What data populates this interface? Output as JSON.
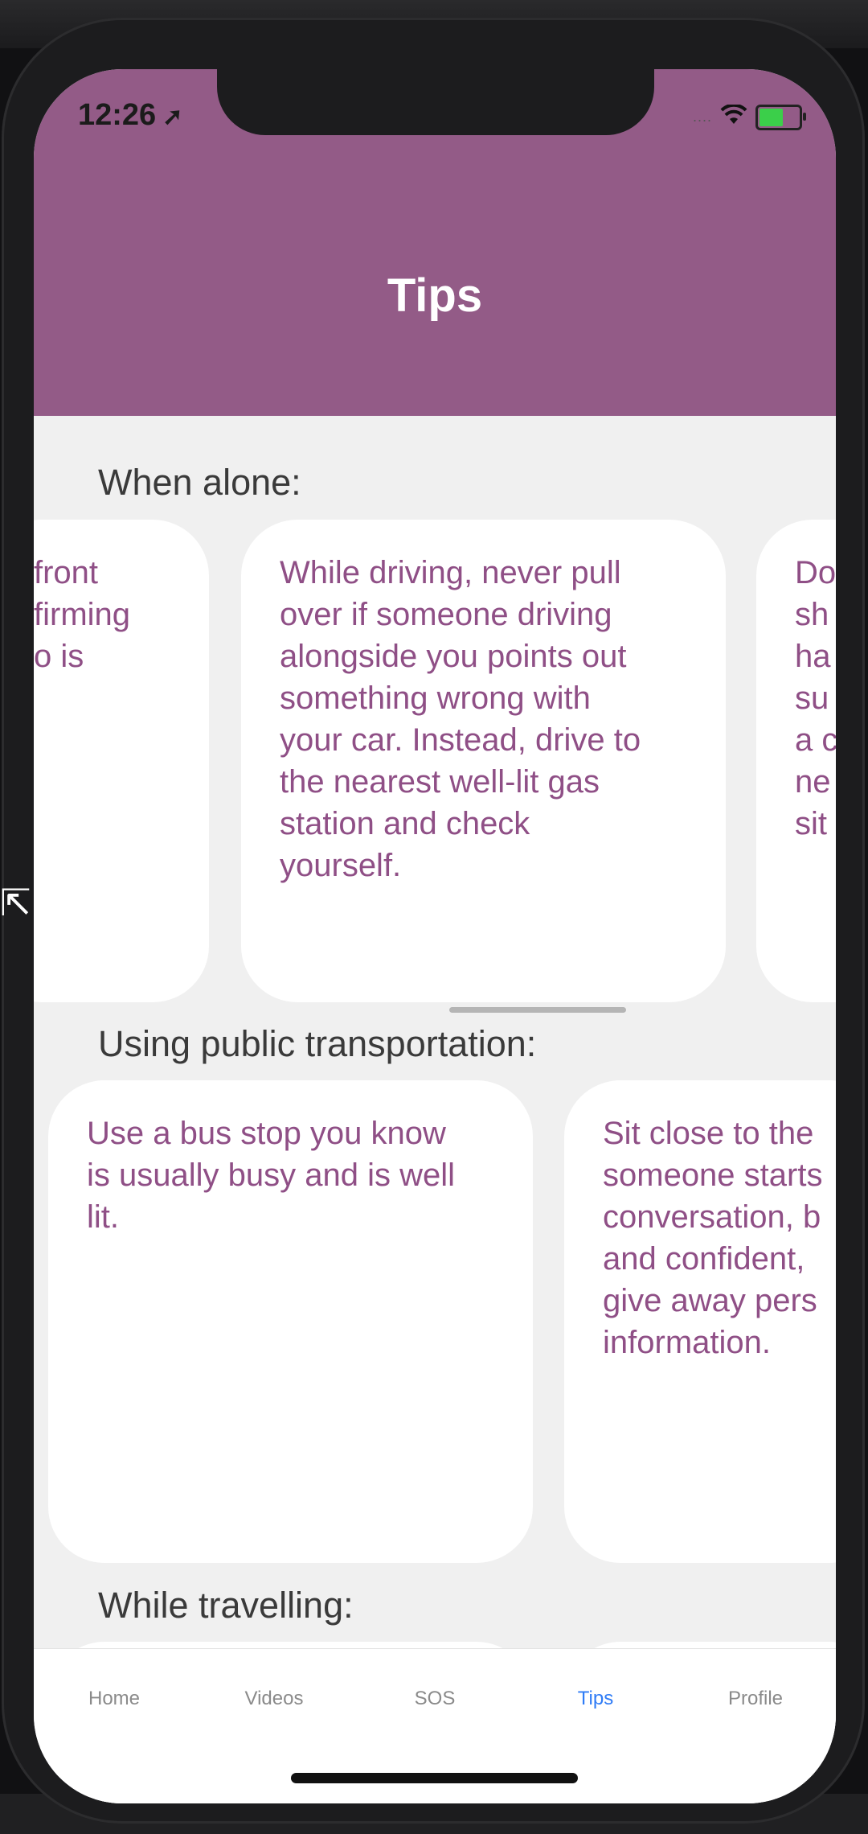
{
  "status_bar": {
    "time": "12:26",
    "signal": "....",
    "wifi_icon": "wifi-icon",
    "battery_icon": "battery-charging-icon"
  },
  "header": {
    "title": "Tips",
    "color": "#935b87"
  },
  "sections": [
    {
      "title": "When alone:",
      "cards": [
        "front\nfirming\no is",
        "While driving, never pull\nover if someone driving\nalongside you points out\nsomething wrong with\nyour car. Instead, drive to\nthe nearest well-lit gas\nstation and check\nyourself.",
        "Do\nsh\nha\nsu\na c\nne\nsit"
      ]
    },
    {
      "title": "Using public transportation:",
      "cards": [
        "Use a bus stop you know\nis usually busy and is well\nlit.",
        "Sit close to the\nsomeone starts\nconversation, b\nand confident, \ngive away pers\ninformation."
      ]
    },
    {
      "title": "While travelling:",
      "cards": []
    }
  ],
  "tabbar": {
    "tabs": [
      {
        "label": "Home"
      },
      {
        "label": "Videos"
      },
      {
        "label": "SOS"
      },
      {
        "label": "Tips",
        "active": true
      },
      {
        "label": "Profile"
      }
    ],
    "active_color": "#2f7cf6"
  }
}
